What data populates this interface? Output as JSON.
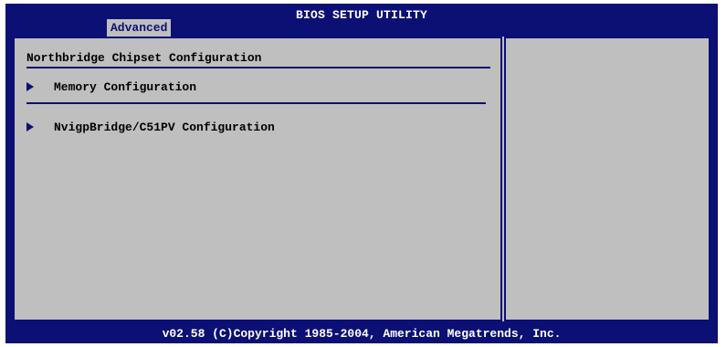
{
  "header": {
    "title": "BIOS SETUP UTILITY",
    "active_tab": "Advanced"
  },
  "main": {
    "section_title": "Northbridge Chipset Configuration",
    "items": [
      {
        "label": "Memory Configuration",
        "icon": "submenu-arrow-icon"
      },
      {
        "label": "NvigpBridge/C51PV Configuration",
        "icon": "submenu-arrow-icon"
      }
    ]
  },
  "help_panel": {
    "text": ""
  },
  "footer": {
    "copyright": "v02.58 (C)Copyright 1985-2004, American Megatrends, Inc."
  },
  "colors": {
    "frame_blue": "#0c0f74",
    "panel_gray": "#bfbfbf",
    "text_white": "#ffffff",
    "text_black": "#000000"
  }
}
